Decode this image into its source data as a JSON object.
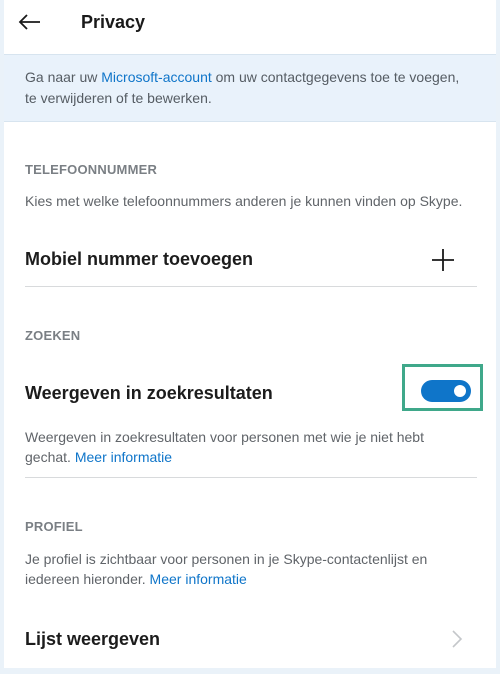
{
  "header": {
    "title": "Privacy"
  },
  "banner": {
    "prefix": "Ga naar uw ",
    "link": "Microsoft-account",
    "suffix": " om uw contactgegevens toe te voegen, te verwijderen of te bewerken."
  },
  "phone_section": {
    "label": "TELEFOONNUMMER",
    "description": "Kies met welke telefoonnummers anderen je kunnen vinden op Skype.",
    "add_label": "Mobiel nummer toevoegen"
  },
  "search_section": {
    "label": "ZOEKEN",
    "toggle_label": "Weergeven in zoekresultaten",
    "toggle_on": true,
    "description": "Weergeven in zoekresultaten voor personen met wie je niet hebt gechat. ",
    "more_link": "Meer informatie"
  },
  "profile_section": {
    "label": "PROFIEL",
    "description": "Je profiel is zichtbaar voor personen in je Skype-contactenlijst en iedereen hieronder. ",
    "more_link": "Meer informatie",
    "list_label": "Lijst weergeven"
  },
  "colors": {
    "accent": "#0f75c9",
    "highlight": "#3fa88a",
    "background": "#eaf2f9"
  },
  "icons": {
    "back": "arrow-left-icon",
    "add": "plus-icon",
    "chevron": "chevron-right-icon"
  }
}
